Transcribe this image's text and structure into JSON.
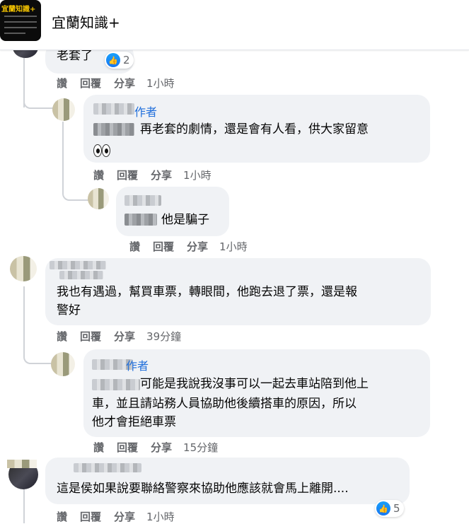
{
  "header": {
    "page_name": "宜蘭知識+",
    "logo_text": "宜蘭知識+"
  },
  "colors": {
    "bubble_bg": "#f0f2f5",
    "author_blue": "#216fdb",
    "action_gray": "#65676b",
    "like_blue": "#1877f2"
  },
  "actions": {
    "like": "讚",
    "reply": "回覆",
    "share": "分享"
  },
  "comments": [
    {
      "text": "老套了",
      "time": "1小時",
      "reactions": "2",
      "reaction_icon": "like-icon"
    },
    {
      "author_tag": "作者",
      "text_line1": "再老套的劇情，還是會有人看，供大家留意",
      "emoji": "eyes-emoji",
      "time": "1小時"
    },
    {
      "text": "他是騙子",
      "time": "1小時"
    },
    {
      "text_line1": "我也有遇過，幫買車票，轉眼間，他跑去退了票，還是報",
      "text_line2": "警好",
      "time": "39分鐘"
    },
    {
      "author_tag": "作者",
      "text_line1": "可能是我說我沒事可以一起去車站陪到他上",
      "text_line2": "車，並且請站務人員協助他後續搭車的原因，所以",
      "text_line3": "他才會拒絕車票",
      "time": "15分鐘"
    },
    {
      "text": "這是侯如果說要聯絡警察來協助他應該就會馬上離開....",
      "time": "1小時",
      "reactions": "5",
      "reaction_icon": "like-icon"
    }
  ]
}
